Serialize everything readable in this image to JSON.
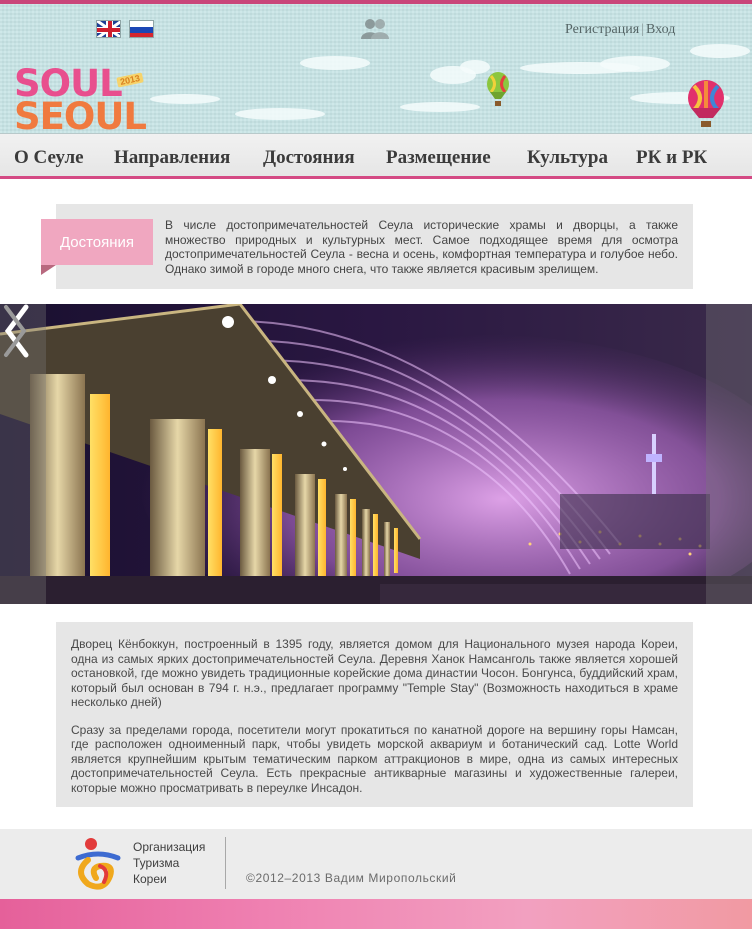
{
  "header": {
    "languages": [
      "English",
      "Русский"
    ],
    "auth": {
      "register": "Регистрация",
      "separator": "|",
      "login": "Вход"
    },
    "logo": {
      "line1": "SOUL",
      "line2": "SEOUL",
      "tag": "2013"
    },
    "brand_colors": {
      "pink": "#e84f8e",
      "orange": "#f07a3f",
      "sky": "#c9e6e7"
    }
  },
  "nav": {
    "items": [
      "О Сеуле",
      "Направления",
      "Достояния",
      "Размещение",
      "Культура",
      "РК и РК"
    ]
  },
  "intro": {
    "label": "Достояния",
    "text": "В числе достопримечательностей Сеула исторические храмы и дворцы, а также множество природных и культурных мест. Самое подходящее время для осмотра достопримечательностей Сеула - весна и осень, комфортная температура и голубое небо. Однако зимой в городе много снега, что также является красивым зрелищем."
  },
  "slider": {
    "prev_icon": "chevron-left-icon",
    "next_icon": "chevron-right-icon"
  },
  "description": {
    "paragraphs": [
      "Дворец Кёнбоккун, построенный в 1395 году, является домом для Национального музея народа Кореи, одна из самых ярких достопримечательностей Сеула. Деревня Ханок Намсанголь также является хорошей остановкой, где можно увидеть традиционные корейские дома династии Чосон. Бонгунса, буддийский храм, который был основан в 794 г. н.э., предлагает программу \"Temple Stay\" (Возможность находиться в храме несколько дней)",
      "Сразу за пределами города, посетители могут прокатиться по канатной дороге на вершину горы Намсан, где расположен одноименный парк, чтобы увидеть морской аквариум и ботанический сад. Lotte World является крупнейшим крытым тематическим парком аттракционов в мире, одна из самых интересных достопримечательностей Сеула. Есть прекрасные антикварные магазины и художественные галереи, которые можно просматривать в переулке Инсадон."
    ]
  },
  "footer": {
    "org_lines": [
      "Организация",
      "Туризма",
      "Кореи"
    ],
    "copyright": "©2012–2013 Вадим Миропольский"
  }
}
